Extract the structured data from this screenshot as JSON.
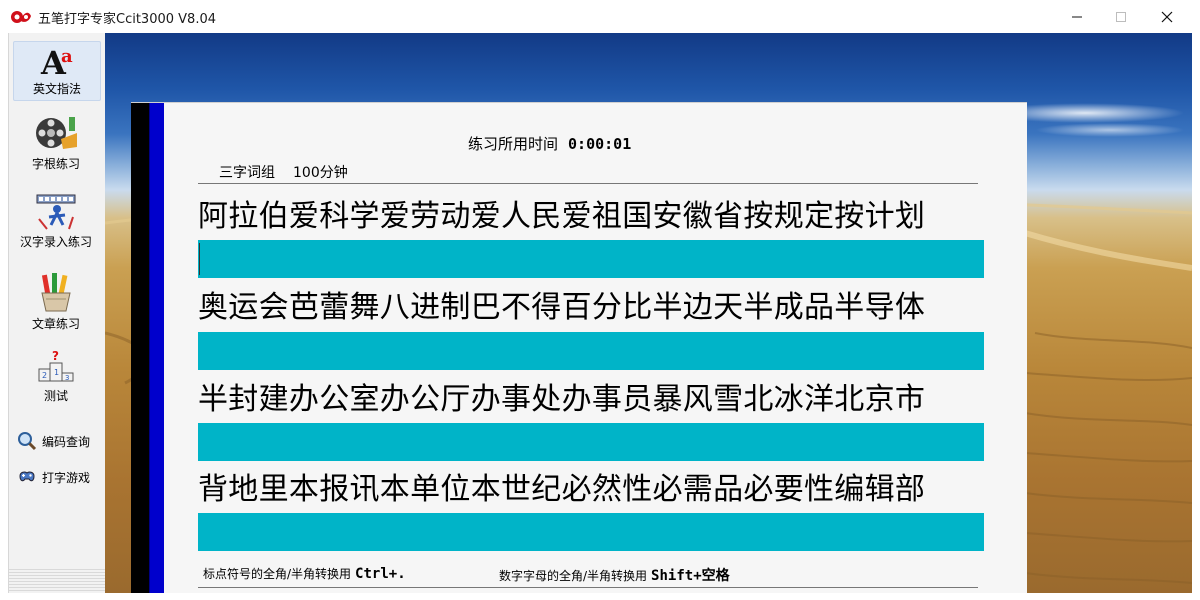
{
  "window": {
    "title": "五笔打字专家Ccit3000 V8.04"
  },
  "colors": {
    "input_bar": "#00b4c8",
    "panel_strip_black": "#000000",
    "panel_strip_blue": "#0000cc",
    "app_icon_red": "#d0101a"
  },
  "sidebar": {
    "items": [
      {
        "label": "英文指法",
        "icon": "english-letter-icon",
        "active": true
      },
      {
        "label": "字根练习",
        "icon": "film-reel-icon",
        "active": false
      },
      {
        "label": "汉字录入练习",
        "icon": "typing-figure-icon",
        "active": false
      },
      {
        "label": "文章练习",
        "icon": "pencil-cup-icon",
        "active": false
      },
      {
        "label": "测试",
        "icon": "podium-icon",
        "active": false
      }
    ],
    "links": [
      {
        "label": "编码查询",
        "icon": "magnifier-icon"
      },
      {
        "label": "打字游戏",
        "icon": "game-controller-icon"
      }
    ]
  },
  "practice": {
    "timer_label": "练习所用时间",
    "timer_value": "0:00:01",
    "lesson_name": "三字词组",
    "lesson_duration": "100分钟",
    "lines": [
      "阿拉伯爱科学爱劳动爱人民爱祖国安徽省按规定按计划",
      "奥运会芭蕾舞八进制巴不得百分比半边天半成品半导体",
      "半封建办公室办公厅办事处办事员暴风雪北冰洋北京市",
      "背地里本报讯本单位本世纪必然性必需品必要性编辑部"
    ],
    "inputs": [
      "",
      "",
      "",
      ""
    ],
    "hint_punct_label": "标点符号的全角/半角转换用",
    "hint_punct_key": "Ctrl+.",
    "hint_digit_label": "数字字母的全角/半角转换用",
    "hint_digit_key": "Shift+空格"
  }
}
